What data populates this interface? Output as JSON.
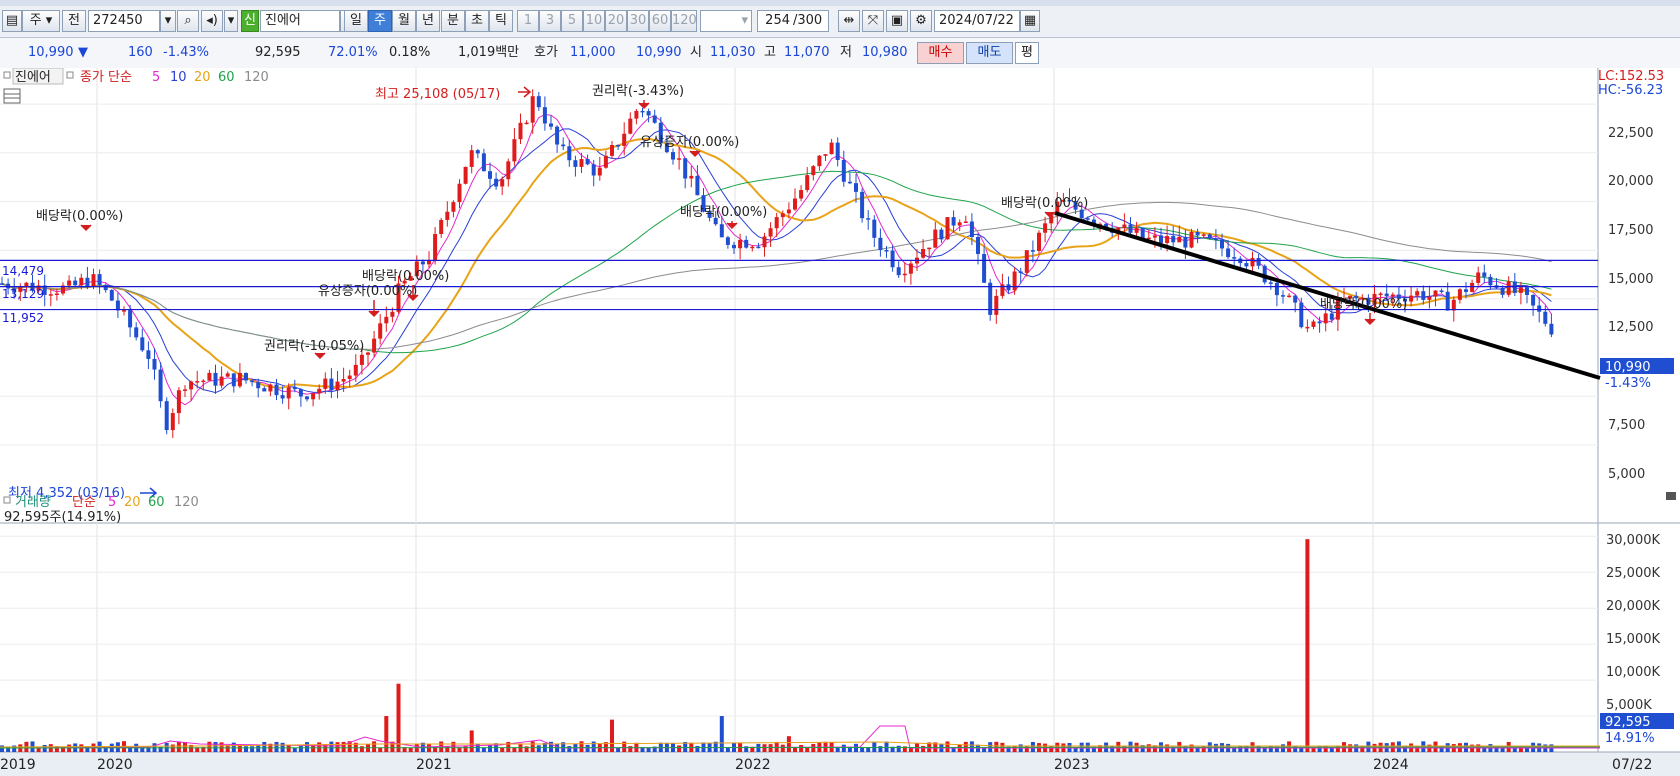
{
  "toolbar": {
    "type_sel": "주",
    "prev_label": "전",
    "code": "272450",
    "badge_new": "신",
    "name": "진에어",
    "periods": [
      "일",
      "주",
      "월",
      "년",
      "분",
      "초",
      "틱"
    ],
    "active_period": "주",
    "intervals": [
      "1",
      "3",
      "5",
      "10",
      "20",
      "30",
      "60",
      "120"
    ],
    "count_value": "254",
    "count_total": "/300",
    "date": "2024/07/22"
  },
  "info": {
    "price": "10,990",
    "arrow": "▼",
    "change": "160",
    "change_pct": "-1.43%",
    "volume": "92,595",
    "volume_ratio": "72.01%",
    "turnover": "0.18%",
    "amount": "1,019백만",
    "bid_label": "호가",
    "ask_price": "11,000",
    "bid_price": "10,990",
    "open_label": "시",
    "open": "11,030",
    "high_label": "고",
    "high": "11,070",
    "low_label": "저",
    "low": "10,980",
    "buy_label": "매수",
    "sell_label": "매도",
    "eval_label": "평"
  },
  "price_panel": {
    "legend_name": "진에어",
    "legend_ma": "종가 단순",
    "ma_periods": [
      "5",
      "10",
      "20",
      "60",
      "120"
    ],
    "lc": "LC:152.53",
    "hc": "HC:-56.23",
    "y_ticks": [
      "22,500",
      "20,000",
      "17,500",
      "15,000",
      "12,500",
      "7,500",
      "5,000"
    ],
    "current_price": "10,990",
    "current_pct": "-1.43%",
    "hline_labels": [
      "14,479",
      "13,129",
      "11,952"
    ],
    "max_note": "최고 25,108 (05/17)",
    "min_note": "최저 4,352 (03/16)",
    "events": [
      {
        "t": "배당락(0.00%)"
      },
      {
        "t": "권리락(-10.05%)"
      },
      {
        "t": "유상증자(0.00%)"
      },
      {
        "t": "배당락(0.00%)"
      },
      {
        "t": "권리락(-3.43%)"
      },
      {
        "t": "유상증자(0.00%)"
      },
      {
        "t": "배당락(0.00%)"
      },
      {
        "t": "배당락(0.00%)"
      },
      {
        "t": "배당락(0.00%)"
      }
    ]
  },
  "volume_panel": {
    "legend_name": "거래량",
    "legend_ma": "단순",
    "ma_periods": [
      "5",
      "20",
      "60",
      "120"
    ],
    "current": "92,595주(14.91%)",
    "y_ticks": [
      "30,000K",
      "25,000K",
      "20,000K",
      "15,000K",
      "10,000K",
      "5,000K"
    ],
    "current_tag": "92,595",
    "current_pct": "14.91%"
  },
  "x_axis": {
    "labels": [
      "2019",
      "2020",
      "2021",
      "2022",
      "2023",
      "2024",
      "07/22"
    ]
  },
  "colors": {
    "up": "#e01b1b",
    "down": "#1f4fd0",
    "ma5": "#e52ad0",
    "ma10": "#2a3fd8",
    "ma20": "#e8a317",
    "ma60": "#1fa34a",
    "ma120": "#8c8c8c",
    "hline": "#1a1ad6",
    "trend": "#000000"
  }
}
